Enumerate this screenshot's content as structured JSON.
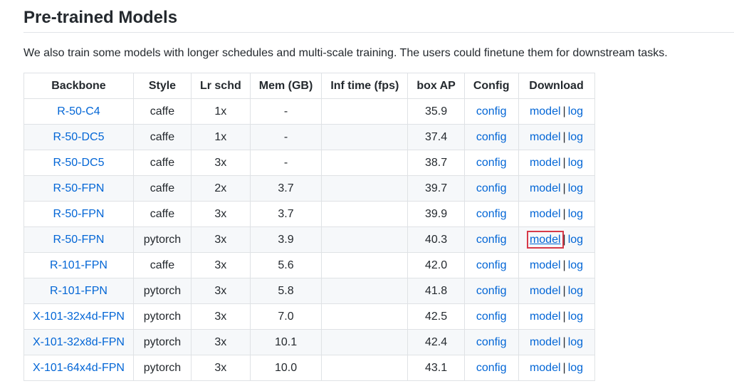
{
  "heading": "Pre-trained Models",
  "intro": "We also train some models with longer schedules and multi-scale training. The users could finetune them for downstream tasks.",
  "table": {
    "columns": [
      "Backbone",
      "Style",
      "Lr schd",
      "Mem (GB)",
      "Inf time (fps)",
      "box AP",
      "Config",
      "Download"
    ],
    "rows": [
      {
        "backbone": "R-50-C4",
        "style": "caffe",
        "lr_schd": "1x",
        "mem": "-",
        "inf_time": "",
        "box_ap": "35.9",
        "config": "config",
        "model": "model",
        "sep": "|",
        "log": "log"
      },
      {
        "backbone": "R-50-DC5",
        "style": "caffe",
        "lr_schd": "1x",
        "mem": "-",
        "inf_time": "",
        "box_ap": "37.4",
        "config": "config",
        "model": "model",
        "sep": "|",
        "log": "log"
      },
      {
        "backbone": "R-50-DC5",
        "style": "caffe",
        "lr_schd": "3x",
        "mem": "-",
        "inf_time": "",
        "box_ap": "38.7",
        "config": "config",
        "model": "model",
        "sep": "|",
        "log": "log"
      },
      {
        "backbone": "R-50-FPN",
        "style": "caffe",
        "lr_schd": "2x",
        "mem": "3.7",
        "inf_time": "",
        "box_ap": "39.7",
        "config": "config",
        "model": "model",
        "sep": "|",
        "log": "log"
      },
      {
        "backbone": "R-50-FPN",
        "style": "caffe",
        "lr_schd": "3x",
        "mem": "3.7",
        "inf_time": "",
        "box_ap": "39.9",
        "config": "config",
        "model": "model",
        "sep": "|",
        "log": "log"
      },
      {
        "backbone": "R-50-FPN",
        "style": "pytorch",
        "lr_schd": "3x",
        "mem": "3.9",
        "inf_time": "",
        "box_ap": "40.3",
        "config": "config",
        "model": "model",
        "sep": "|",
        "log": "log",
        "highlighted": true
      },
      {
        "backbone": "R-101-FPN",
        "style": "caffe",
        "lr_schd": "3x",
        "mem": "5.6",
        "inf_time": "",
        "box_ap": "42.0",
        "config": "config",
        "model": "model",
        "sep": "|",
        "log": "log"
      },
      {
        "backbone": "R-101-FPN",
        "style": "pytorch",
        "lr_schd": "3x",
        "mem": "5.8",
        "inf_time": "",
        "box_ap": "41.8",
        "config": "config",
        "model": "model",
        "sep": "|",
        "log": "log"
      },
      {
        "backbone": "X-101-32x4d-FPN",
        "style": "pytorch",
        "lr_schd": "3x",
        "mem": "7.0",
        "inf_time": "",
        "box_ap": "42.5",
        "config": "config",
        "model": "model",
        "sep": "|",
        "log": "log"
      },
      {
        "backbone": "X-101-32x8d-FPN",
        "style": "pytorch",
        "lr_schd": "3x",
        "mem": "10.1",
        "inf_time": "",
        "box_ap": "42.4",
        "config": "config",
        "model": "model",
        "sep": "|",
        "log": "log"
      },
      {
        "backbone": "X-101-64x4d-FPN",
        "style": "pytorch",
        "lr_schd": "3x",
        "mem": "10.0",
        "inf_time": "",
        "box_ap": "43.1",
        "config": "config",
        "model": "model",
        "sep": "|",
        "log": "log"
      }
    ]
  },
  "colors": {
    "link": "#0366d6",
    "text": "#24292e",
    "border": "#dfe2e5",
    "stripe": "#f6f8fa",
    "highlight_box": "#d73a49"
  }
}
